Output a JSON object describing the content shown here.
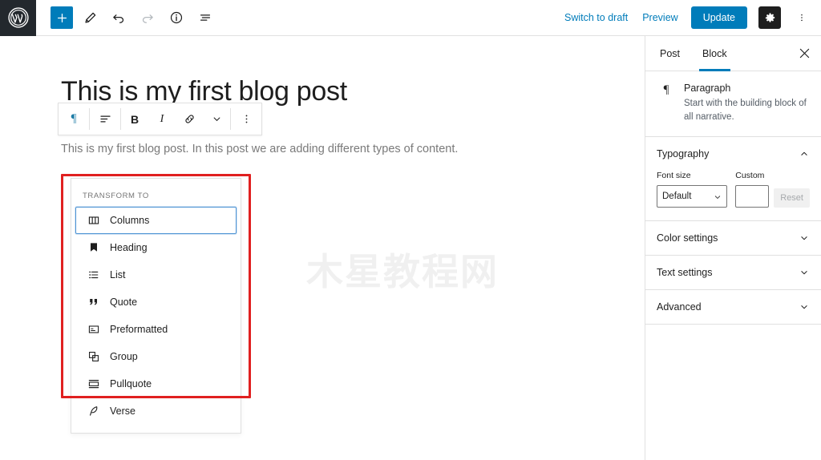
{
  "topbar": {
    "logo": "wordpress-logo",
    "left_tools": [
      {
        "name": "add-block-button",
        "icon": "plus-icon",
        "label": "+"
      },
      {
        "name": "edit-tool-button",
        "icon": "pencil-icon",
        "label": ""
      },
      {
        "name": "undo-button",
        "icon": "undo-icon",
        "label": ""
      },
      {
        "name": "redo-button",
        "icon": "redo-icon",
        "label": ""
      },
      {
        "name": "details-button",
        "icon": "info-icon",
        "label": ""
      },
      {
        "name": "list-view-button",
        "icon": "list-view-icon",
        "label": ""
      }
    ],
    "switch_to_draft": "Switch to draft",
    "preview": "Preview",
    "update": "Update",
    "settings_icon": "gear-icon",
    "more_icon": "ellipsis-vertical-icon"
  },
  "editor": {
    "title": "This is my first blog post",
    "paragraph": "This is my first blog post. In this post we are adding different types of content.",
    "watermark": "木星教程网"
  },
  "block_toolbar": {
    "items": [
      {
        "name": "block-type-paragraph-button",
        "icon": "pilcrow-icon",
        "label": "¶",
        "active": true
      },
      {
        "name": "align-text-button",
        "icon": "align-left-icon",
        "label": ""
      },
      {
        "name": "bold-button",
        "icon": "bold-icon",
        "label": "B"
      },
      {
        "name": "italic-button",
        "icon": "italic-icon",
        "label": "I"
      },
      {
        "name": "link-button",
        "icon": "link-icon",
        "label": ""
      },
      {
        "name": "more-rich-text-button",
        "icon": "chevron-down-icon",
        "label": ""
      },
      {
        "name": "block-options-button",
        "icon": "ellipsis-vertical-icon",
        "label": ""
      }
    ]
  },
  "transform_menu": {
    "header": "TRANSFORM TO",
    "items": [
      {
        "label": "Columns",
        "icon": "columns-icon",
        "selected": true
      },
      {
        "label": "Heading",
        "icon": "heading-icon",
        "selected": false
      },
      {
        "label": "List",
        "icon": "list-icon",
        "selected": false
      },
      {
        "label": "Quote",
        "icon": "quote-icon",
        "selected": false
      },
      {
        "label": "Preformatted",
        "icon": "preformatted-icon",
        "selected": false
      },
      {
        "label": "Group",
        "icon": "group-icon",
        "selected": false
      },
      {
        "label": "Pullquote",
        "icon": "pullquote-icon",
        "selected": false
      },
      {
        "label": "Verse",
        "icon": "verse-icon",
        "selected": false
      }
    ]
  },
  "sidebar": {
    "tabs": [
      {
        "label": "Post",
        "active": false
      },
      {
        "label": "Block",
        "active": true
      }
    ],
    "close_label": "✕",
    "block_card": {
      "icon": "pilcrow-icon",
      "title": "Paragraph",
      "description": "Start with the building block of all narrative."
    },
    "panels": [
      {
        "title": "Typography",
        "expanded": true
      },
      {
        "title": "Color settings",
        "expanded": false
      },
      {
        "title": "Text settings",
        "expanded": false
      },
      {
        "title": "Advanced",
        "expanded": false
      }
    ],
    "typography": {
      "font_size_label": "Font size",
      "font_size_value": "Default",
      "custom_label": "Custom",
      "custom_value": "",
      "custom_placeholder": "",
      "reset_label": "Reset"
    }
  },
  "colors": {
    "accent": "#007cba",
    "annotation": "#e02020",
    "admin_bar": "#23282d",
    "selected_outline": "#4f94d4"
  }
}
